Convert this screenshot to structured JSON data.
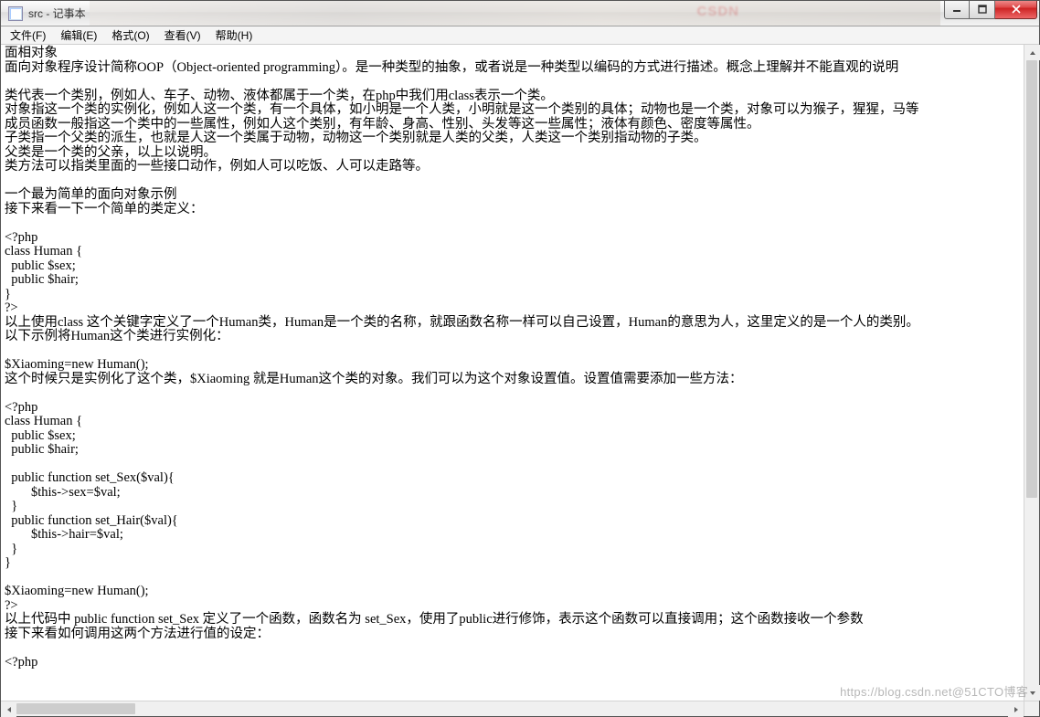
{
  "title": "src - 记事本",
  "menus": {
    "file": "文件(F)",
    "edit": "编辑(E)",
    "format": "格式(O)",
    "view": "查看(V)",
    "help": "帮助(H)"
  },
  "content": "面相对象\n面向对象程序设计简称OOP（Object-oriented programming）。是一种类型的抽象，或者说是一种类型以编码的方式进行描述。概念上理解并不能直观的说明\n\n类代表一个类别，例如人、车子、动物、液体都属于一个类，在php中我们用class表示一个类。\n对象指这一个类的实例化，例如人这一个类，有一个具体，如小明是一个人类，小明就是这一个类别的具体；动物也是一个类，对象可以为猴子，猩猩，马等\n成员函数一般指这一个类中的一些属性，例如人这个类别，有年龄、身高、性别、头发等这一些属性；液体有颜色、密度等属性。\n子类指一个父类的派生，也就是人这一个类属于动物，动物这一个类别就是人类的父类，人类这一个类别指动物的子类。\n父类是一个类的父亲，以上以说明。\n类方法可以指类里面的一些接口动作，例如人可以吃饭、人可以走路等。\n\n一个最为简单的面向对象示例\n接下来看一下一个简单的类定义：\n\n<?php\nclass Human {\n  public $sex;\n  public $hair;\n}\n?>\n以上使用class 这个关键字定义了一个Human类，Human是一个类的名称，就跟函数名称一样可以自己设置，Human的意思为人，这里定义的是一个人的类别。\n以下示例将Human这个类进行实例化：\n\n$Xiaoming=new Human();\n这个时候只是实例化了这个类，$Xiaoming 就是Human这个类的对象。我们可以为这个对象设置值。设置值需要添加一些方法：\n\n<?php\nclass Human {\n  public $sex;\n  public $hair;\n\n  public function set_Sex($val){\n        $this->sex=$val;\n  }\n  public function set_Hair($val){\n        $this->hair=$val;\n  }\n}\n\n$Xiaoming=new Human();\n?>\n以上代码中 public function set_Sex 定义了一个函数，函数名为 set_Sex，使用了public进行修饰，表示这个函数可以直接调用；这个函数接收一个参数\n接下来看如何调用这两个方法进行值的设定：\n\n<?php",
  "watermark": "https://blog.csdn.net@51CTO博客"
}
